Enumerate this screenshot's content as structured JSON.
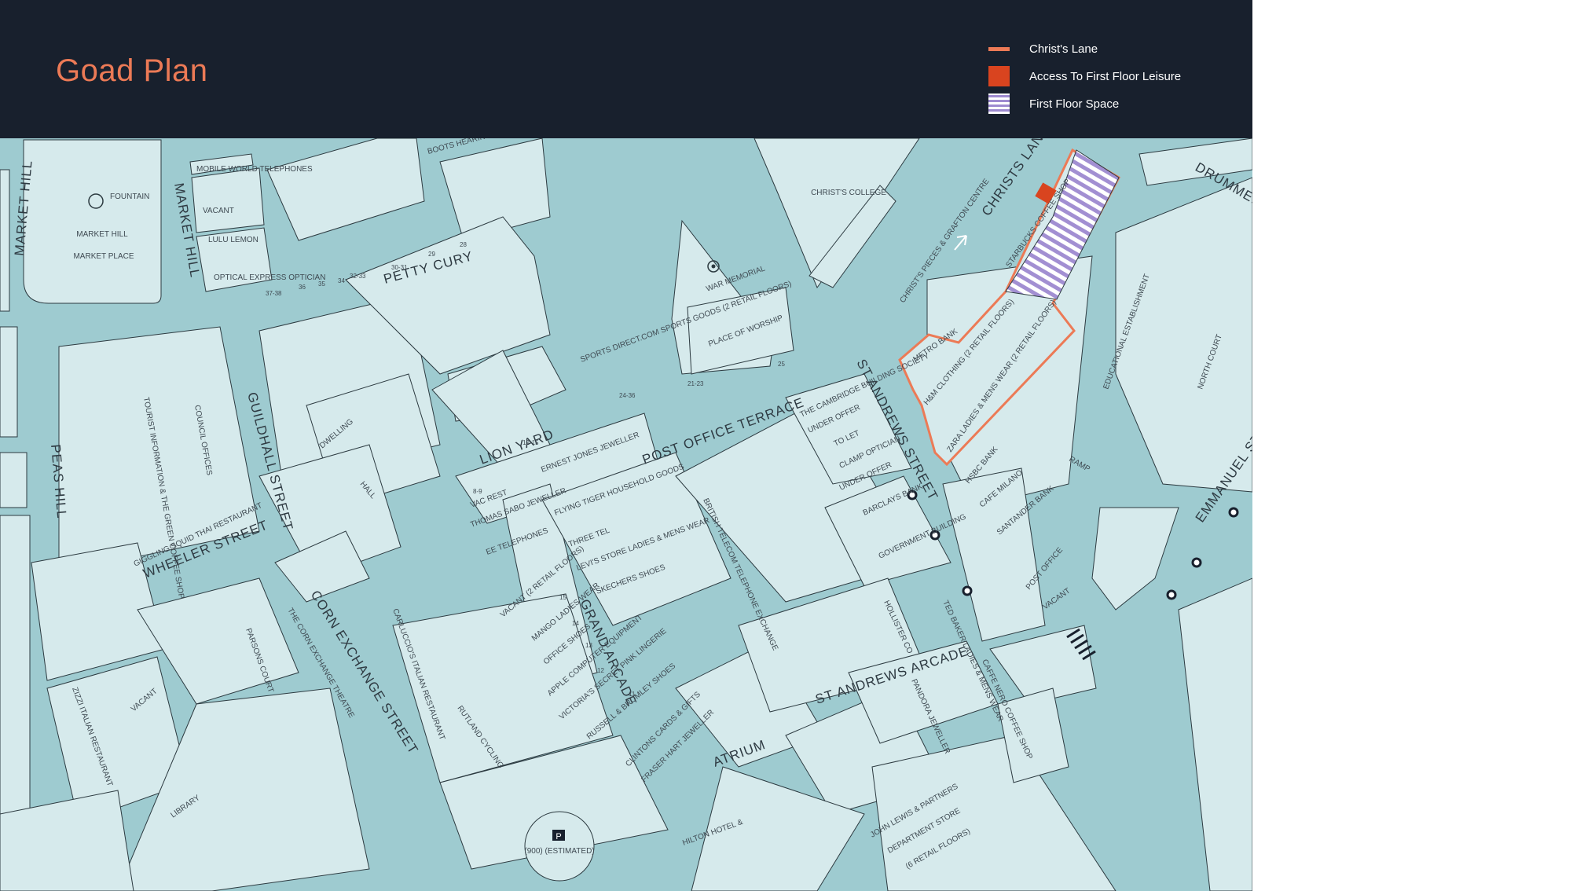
{
  "header": {
    "title": "Goad Plan"
  },
  "legend": [
    {
      "label": "Christ's Lane",
      "swatch": "line",
      "color": "#ec7a56"
    },
    {
      "label": "Access To First Floor Leisure",
      "swatch": "solid",
      "color": "#d9441f"
    },
    {
      "label": "First Floor Space",
      "swatch": "hatch",
      "color": "#9e8ad0"
    }
  ],
  "colors": {
    "road": "#9ecbd0",
    "block": "#d6eaec",
    "outline": "#2c3a40",
    "highlight": "#ec7a56",
    "header_bg": "#18202d"
  },
  "map": {
    "streets": {
      "market_hill_left": "MARKET HILL",
      "market_hill_mid": "MARKET HILL",
      "petty_cury": "PETTY CURY",
      "guildhall_street": "GUILDHALL STREET",
      "peas_hill": "PEAS HILL",
      "wheeler_street": "WHEELER STREET",
      "corn_exchange_street": "CORN EXCHANGE STREET",
      "lion_yard": "LION YARD",
      "grand_arcade": "GRAND ARCADE",
      "post_office_terrace": "POST OFFICE TERRACE",
      "st_andrews_street": "ST ANDREWS STREET",
      "st_andrews_arcade": "ST ANDREWS ARCADE",
      "christs_lane": "CHRISTS LANE",
      "emmanuel_street": "EMMANUEL STREET",
      "drummer_bus_station": "DRUMMER ST BUS STATION",
      "atrium": "ATRIUM"
    },
    "places": {
      "market_hill": "MARKET HILL",
      "market_place": "MARKET PLACE",
      "fountain": "FOUNTAIN",
      "tourist_information": "TOURIST INFORMATION & THE GREEN COFFEE SHOP",
      "council_offices": "COUNCIL OFFICES",
      "christs_college": "CHRIST'S COLLEGE",
      "war_memorial": "WAR MEMORIAL",
      "place_of_worship": "PLACE OF WORSHIP",
      "christs_pieces": "CHRIST'S PIECES & GRAFTON CENTRE",
      "educational_establishment": "EDUCATIONAL ESTABLISHMENT",
      "north_court": "NORTH COURT",
      "ramp": "RAMP",
      "library": "LIBRARY",
      "corn_exchange_theatre": "THE CORN EXCHANGE THEATRE",
      "john_lewis": "JOHN LEWIS & PARTNERS",
      "department_store": "DEPARTMENT STORE",
      "retail_floors": "(6 RETAIL FLOORS)",
      "hilton_hotel": "HILTON HOTEL &",
      "parking": "P",
      "parking_spaces": "(900) (ESTIMATED)",
      "british_telecom": "BRITISH TELECOM TELEPHONE EXCHANGE",
      "dwelling": "DWELLING",
      "hall": "HALL",
      "carluccios": "CARLUCCIO'S ITALIAN RESTAURANT",
      "parsons_court": "PARSONS COURT"
    },
    "units": {
      "mobile_world": "MOBILE WORLD TELEPHONES",
      "vacant_1": "VACANT",
      "lulu_lemon": "LULU LEMON",
      "optical_express": "OPTICAL EXPRESS OPTICIAN",
      "boots_hearing": "BOOTS HEARING",
      "metro_bank": "METRO BANK",
      "hm": "H&M CLOTHING (2 RETAIL FLOORS)",
      "zara": "ZARA LADIES & MENS WEAR (2 RETAIL FLOORS)",
      "hsbc": "HSBC BANK",
      "cafe_milano": "CAFE MILANO",
      "santander": "SANTANDER BANK",
      "post_office": "POST OFFICE",
      "vacant_2": "VACANT",
      "starbucks": "STARBUCKS COFFEE SHOP",
      "cambridge_building_society": "THE CAMBRIDGE BUILDING SOCIETY",
      "under_offer_1": "UNDER OFFER",
      "to_let": "TO LET",
      "clamp_optician": "CLAMP OPTICIAN",
      "under_offer_2": "UNDER OFFER",
      "barclays": "BARCLAYS BANK",
      "government_building": "GOVERNMENT BUILDING",
      "sports_direct": "SPORTS DIRECT.COM SPORTS GOODS (2 RETAIL FLOORS)",
      "ernest_jones": "ERNEST JONES JEWELLER",
      "flying_tiger": "FLYING TIGER HOUSEHOLD GOODS",
      "three": "THREE TEL",
      "levis": "LEVI'S STORE LADIES & MENS WEAR",
      "skechers": "SKECHERS SHOES",
      "vac_rest": "VAC REST",
      "thomas_sabo": "THOMAS SABO JEWELLER",
      "ee": "EE TELEPHONES",
      "mango": "MANGO LADIES WEAR",
      "office": "OFFICE SHOES",
      "apple": "APPLE COMPUTER EQUIPMENT",
      "victorias_secret": "VICTORIA'S SECRET PINK LINGERIE",
      "russell_bromley": "RUSSELL & BROMLEY SHOES",
      "clintons": "CLINTONS CARDS & GIFTS",
      "fraser_hart": "FRASER HART JEWELLER",
      "vacant_grand": "VACANT (2 RETAIL FLOORS)",
      "rutland_cycling": "RUTLAND CYCLING",
      "hollister": "HOLLISTER CO",
      "ted_baker": "TED BAKER LADIES & MENS WEAR",
      "caffe_nero": "CAFFE NERO COFFEE SHOP",
      "pandora": "PANDORA JEWELLER",
      "giggling_squid": "GIGGLING SQUID THAI RESTAURANT",
      "zizzi": "ZIZZI ITALIAN RESTAURANT",
      "vacant_3": "VACANT"
    },
    "numbers": [
      "37-38",
      "36",
      "35",
      "34",
      "32-33",
      "30-31",
      "29",
      "28",
      "24-36",
      "21-23",
      "25",
      "12-15",
      "8-9",
      "15",
      "14",
      "13",
      "12",
      "11"
    ]
  }
}
